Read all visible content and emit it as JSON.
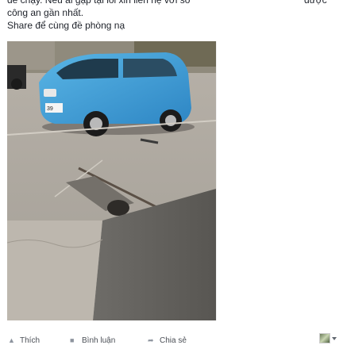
{
  "post": {
    "lines": [
      "để chạy. Nếu ai gặp tại lỗi xin liên hệ với số",
      "công an gần nhất.",
      "Share để cùng đề phòng nạ"
    ],
    "trailing_word": "được"
  },
  "photo": {
    "plate_text": "39"
  },
  "actions": {
    "like_label": "Thích",
    "comment_label": "Bình luận",
    "share_label": "Chia sẻ"
  },
  "icons": {
    "like": "thumbs-up-icon",
    "comment": "comment-icon",
    "share": "share-icon",
    "audience": "avatar-icon"
  }
}
